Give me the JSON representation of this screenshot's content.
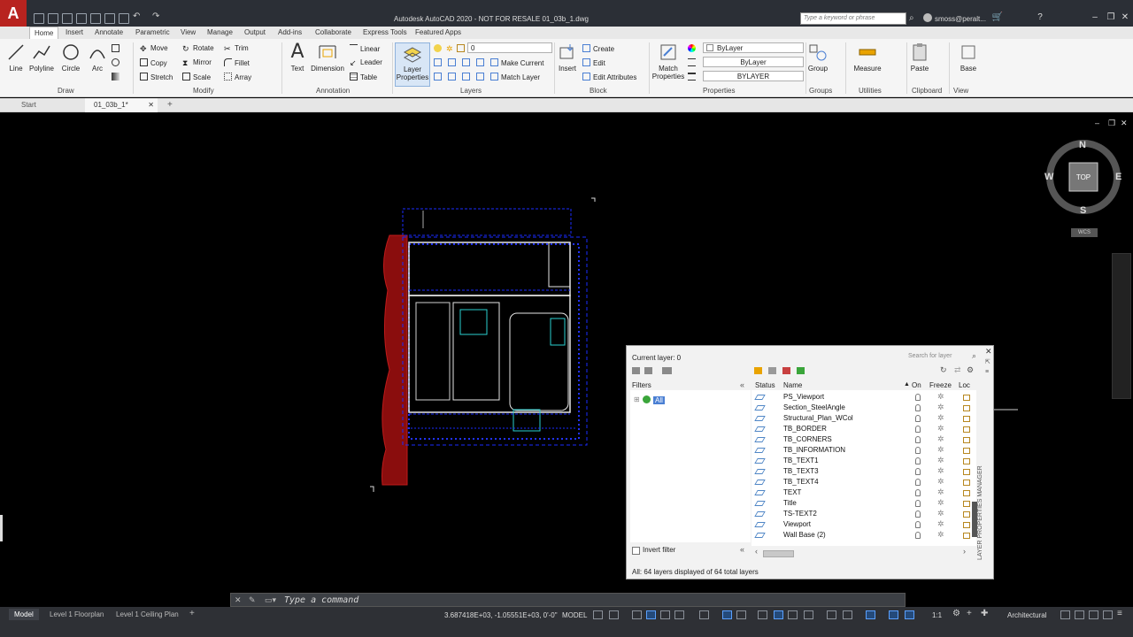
{
  "app": {
    "title": "Autodesk AutoCAD 2020 - NOT FOR RESALE   01_03b_1.dwg",
    "logo": "A",
    "search_placeholder": "Type a keyword or phrase",
    "user": "smoss@peralt..."
  },
  "ribbon_tabs": [
    "Home",
    "Insert",
    "Annotate",
    "Parametric",
    "View",
    "Manage",
    "Output",
    "Add-ins",
    "Collaborate",
    "Express Tools",
    "Featured Apps"
  ],
  "ribbon": {
    "draw": {
      "title": "Draw",
      "line": "Line",
      "polyline": "Polyline",
      "circle": "Circle",
      "arc": "Arc"
    },
    "modify": {
      "title": "Modify",
      "move": "Move",
      "rotate": "Rotate",
      "trim": "Trim",
      "copy": "Copy",
      "mirror": "Mirror",
      "fillet": "Fillet",
      "stretch": "Stretch",
      "scale": "Scale",
      "array": "Array"
    },
    "annotation": {
      "title": "Annotation",
      "text": "Text",
      "dimension": "Dimension",
      "linear": "Linear",
      "leader": "Leader",
      "table": "Table"
    },
    "layers": {
      "title": "Layers",
      "layer_properties": "Layer Properties",
      "current_layer": "0",
      "make_current": "Make Current",
      "match_layer": "Match Layer"
    },
    "block": {
      "title": "Block",
      "insert": "Insert",
      "create": "Create",
      "edit": "Edit",
      "edit_attributes": "Edit Attributes"
    },
    "properties": {
      "title": "Properties",
      "match_properties": "Match Properties",
      "color": "ByLayer",
      "linetype": "ByLayer",
      "lineweight": "BYLAYER"
    },
    "groups": {
      "title": "Groups",
      "group": "Group"
    },
    "utilities": {
      "title": "Utilities",
      "measure": "Measure"
    },
    "clipboard": {
      "title": "Clipboard",
      "paste": "Paste"
    },
    "view": {
      "title": "View",
      "base": "Base"
    }
  },
  "doc_tabs": {
    "start": "Start",
    "file": "01_03b_1*"
  },
  "viewcube": {
    "n": "N",
    "s": "S",
    "e": "E",
    "w": "W",
    "face": "TOP",
    "wcs": "WCS"
  },
  "layer_palette": {
    "current_layer": "Current layer: 0",
    "search_placeholder": "Search for layer",
    "filters_label": "Filters",
    "filter_all": "All",
    "columns": {
      "status": "Status",
      "name": "Name",
      "on": "On",
      "freeze": "Freeze",
      "lock": "Loc"
    },
    "layers": [
      "PS_Viewport",
      "Section_SteelAngle",
      "Structural_Plan_WCol",
      "TB_BORDER",
      "TB_CORNERS",
      "TB_INFORMATION",
      "TB_TEXT1",
      "TB_TEXT3",
      "TB_TEXT4",
      "TEXT",
      "Title",
      "TS-TEXT2",
      "Viewport",
      "Wall Base (2)"
    ],
    "invert_filter": "Invert filter",
    "footer": "All: 64 layers displayed of 64 total layers",
    "side_label": "LAYER PROPERTIES MANAGER"
  },
  "command": {
    "placeholder": "Type a command"
  },
  "status": {
    "layout_tabs": [
      "Model",
      "Level 1 Floorplan",
      "Level 1 Ceiling Plan"
    ],
    "coords": "3.687418E+03, -1.05551E+03, 0'-0\"",
    "model": "MODEL",
    "scale": "1:1",
    "units": "Architectural"
  },
  "colors": {
    "accent": "#4a7fd3",
    "brand": "#b8231f",
    "drawing_blue": "#1a2cff",
    "drawing_red": "#a01010"
  }
}
